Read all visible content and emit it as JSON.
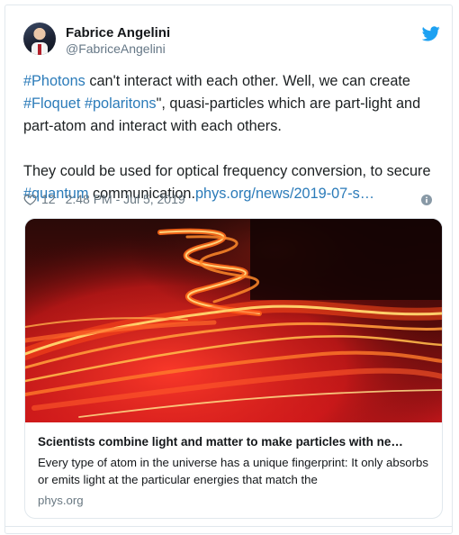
{
  "user": {
    "name": "Fabrice Angelini",
    "handle": "@FabriceAngelini"
  },
  "tweet": {
    "para1": [
      {
        "text": "#Photons",
        "type": "hashtag"
      },
      {
        "text": " can't interact with each other. Well, we can create ",
        "type": "text"
      },
      {
        "text": "#Floquet",
        "type": "hashtag"
      },
      {
        "text": " ",
        "type": "text"
      },
      {
        "text": "#polaritons",
        "type": "hashtag"
      },
      {
        "text": "\", quasi-particles which are part-light and part-atom and  interact with each others.",
        "type": "text"
      }
    ],
    "para2": [
      {
        "text": "They could be used for optical frequency conversion, to secure ",
        "type": "text"
      },
      {
        "text": "#quantum",
        "type": "hashtag"
      },
      {
        "text": " communication.",
        "type": "text"
      },
      {
        "text": "phys.org/news/2019-07-s…",
        "type": "link"
      }
    ]
  },
  "meta": {
    "likes": "12",
    "timestamp": "2:48 PM - Jul 5, 2019"
  },
  "card": {
    "title": "Scientists combine light and matter to make particles with ne…",
    "description": "Every type of atom in the universe has a unique fingerprint: It only absorbs or emits light at the particular energies that match the",
    "domain": "phys.org"
  },
  "icons": {
    "bird": "twitter-bird-icon",
    "heart": "heart-icon",
    "info": "info-icon"
  },
  "colors": {
    "link": "#2b7bb9",
    "twitter_blue": "#1da1f2",
    "meta_gray": "#697882"
  }
}
